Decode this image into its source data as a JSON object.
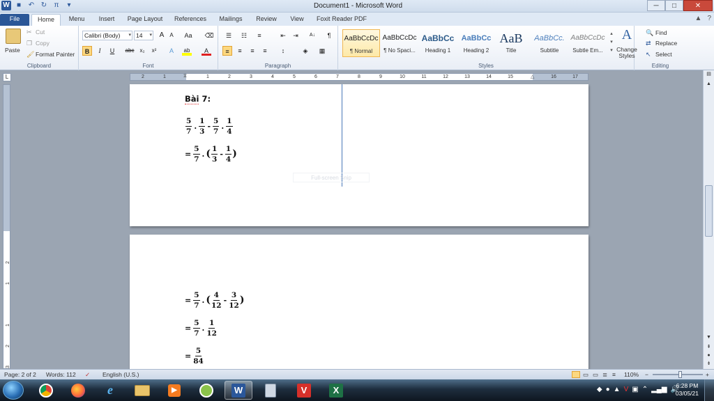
{
  "window": {
    "title": "Document1 - Microsoft Word",
    "min": "─",
    "max": "□",
    "close": "✕"
  },
  "qat": {
    "save": "💾",
    "undo": "↶",
    "redo": "↻",
    "pi": "π",
    "more": "▾"
  },
  "tabs": [
    {
      "label": "File"
    },
    {
      "label": "Home"
    },
    {
      "label": "Menu"
    },
    {
      "label": "Insert"
    },
    {
      "label": "Page Layout"
    },
    {
      "label": "References"
    },
    {
      "label": "Mailings"
    },
    {
      "label": "Review"
    },
    {
      "label": "View"
    },
    {
      "label": "Foxit Reader PDF"
    }
  ],
  "help": {
    "collapse": "▲",
    "help": "?"
  },
  "clipboard": {
    "paste": "Paste",
    "cut": "Cut",
    "copy": "Copy",
    "format_painter": "Format Painter",
    "label": "Clipboard"
  },
  "font": {
    "name": "Calibri (Body)",
    "size": "14",
    "label": "Font",
    "grow": "A",
    "shrink": "A",
    "case": "Aa",
    "bold": "B",
    "italic": "I",
    "underline": "U",
    "strike": "abc",
    "sub": "x₂",
    "sup": "x²",
    "effects": "A",
    "highlight": "ab",
    "color": "A"
  },
  "paragraph": {
    "label": "Paragraph",
    "pilcrow": "¶",
    "sort": "A↓"
  },
  "styles": {
    "label": "Styles",
    "items": [
      {
        "preview": "AaBbCcDc",
        "name": "¶ Normal"
      },
      {
        "preview": "AaBbCcDc",
        "name": "¶ No Spaci..."
      },
      {
        "preview": "AaBbCc",
        "name": "Heading 1"
      },
      {
        "preview": "AaBbCc",
        "name": "Heading 2"
      },
      {
        "preview": "AaB",
        "name": "Title"
      },
      {
        "preview": "AaBbCc.",
        "name": "Subtitle"
      },
      {
        "preview": "AaBbCcDc",
        "name": "Subtle Em..."
      }
    ],
    "change_styles": "Change Styles",
    "change_icon": "A"
  },
  "editing": {
    "label": "Editing",
    "find": "Find",
    "replace": "Replace",
    "select": "Select"
  },
  "ruler": {
    "marks": [
      "2",
      "1",
      "1",
      "2",
      "3",
      "4",
      "5",
      "6",
      "7",
      "8",
      "9",
      "10",
      "11",
      "12",
      "13",
      "14",
      "15",
      "16",
      "17",
      "18"
    ],
    "vmarks": [
      "2",
      "1",
      "1",
      "2",
      "3"
    ],
    "tab_stop": "L"
  },
  "document": {
    "heading": "Bài 7:",
    "heading_squiggle": "Bài",
    "heading_rest": " 7:",
    "ghost_text": "Full-screen Snip",
    "line1": {
      "a": {
        "n": "5",
        "d": "7"
      },
      "b": {
        "n": "1",
        "d": "3"
      },
      "c": {
        "n": "5",
        "d": "7"
      },
      "e": {
        "n": "1",
        "d": "4"
      }
    },
    "line2": {
      "eq": "=",
      "a": {
        "n": "5",
        "d": "7"
      },
      "b": {
        "n": "1",
        "d": "3"
      },
      "c": {
        "n": "1",
        "d": "4"
      }
    },
    "line3": {
      "eq": "=",
      "a": {
        "n": "5",
        "d": "7"
      },
      "b": {
        "n": "4",
        "d": "12"
      },
      "c": {
        "n": "3",
        "d": "12"
      }
    },
    "line4": {
      "eq": "=",
      "a": {
        "n": "5",
        "d": "7"
      },
      "b": {
        "n": "1",
        "d": "12"
      }
    },
    "line5": {
      "eq": "=",
      "a": {
        "n": "5",
        "d": "84"
      }
    },
    "ops": {
      "dot": ".",
      "minus": "-",
      "lparen": "(",
      "rparen": ")"
    }
  },
  "status": {
    "page": "Page: 2 of 2",
    "words": "Words: 112",
    "language": "English (U.S.)",
    "zoom": "110%",
    "zoom_out": "−",
    "zoom_in": "+",
    "zoom_level": 0.55
  },
  "taskbar": {
    "time": "6:28 PM",
    "date": "03/05/21",
    "apps": [
      "chrome-icon",
      "firefox-icon",
      "ie-icon",
      "explorer-icon",
      "media-icon",
      "greenshot-icon",
      "word-icon",
      "calculator-icon",
      "foxit-icon",
      "excel-icon"
    ],
    "word_glyph": "W",
    "excel_glyph": "X",
    "foxit_glyph": "V"
  },
  "colors": {
    "accent": "#2b579a",
    "file_tab": "#2b5797"
  }
}
